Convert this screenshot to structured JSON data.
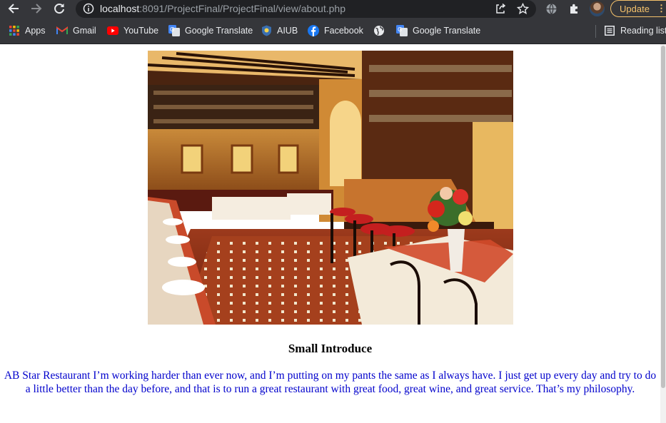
{
  "browser": {
    "url_host": "localhost",
    "url_rest": ":8091/ProjectFinal/ProjectFinal/view/about.php",
    "update_label": "Update",
    "update_menu": "⋮"
  },
  "bookmarks": {
    "items": [
      {
        "label": "Apps",
        "icon": "apps-grid-icon"
      },
      {
        "label": "Gmail",
        "icon": "gmail-icon"
      },
      {
        "label": "YouTube",
        "icon": "youtube-icon"
      },
      {
        "label": "Google Translate",
        "icon": "google-translate-icon"
      },
      {
        "label": "AIUB",
        "icon": "aiub-shield-icon"
      },
      {
        "label": "Facebook",
        "icon": "facebook-icon"
      },
      {
        "label": "",
        "icon": "globe-icon"
      },
      {
        "label": "Google Translate",
        "icon": "google-translate-icon"
      }
    ],
    "reading_list": "Reading list"
  },
  "page": {
    "title": "Small Introduce",
    "intro": "AB Star Restaurant I’m working harder than ever now, and I’m putting on my pants the same as I always have. I just get up every day and try to do a little better than the day before, and that is to run a great restaurant with great food, great wine, and great service. That’s my philosophy."
  },
  "colors": {
    "chrome_bg": "#35363a",
    "omnibox_bg": "#202124",
    "update_accent": "#f5c26b",
    "intro_text": "#0000cc"
  }
}
